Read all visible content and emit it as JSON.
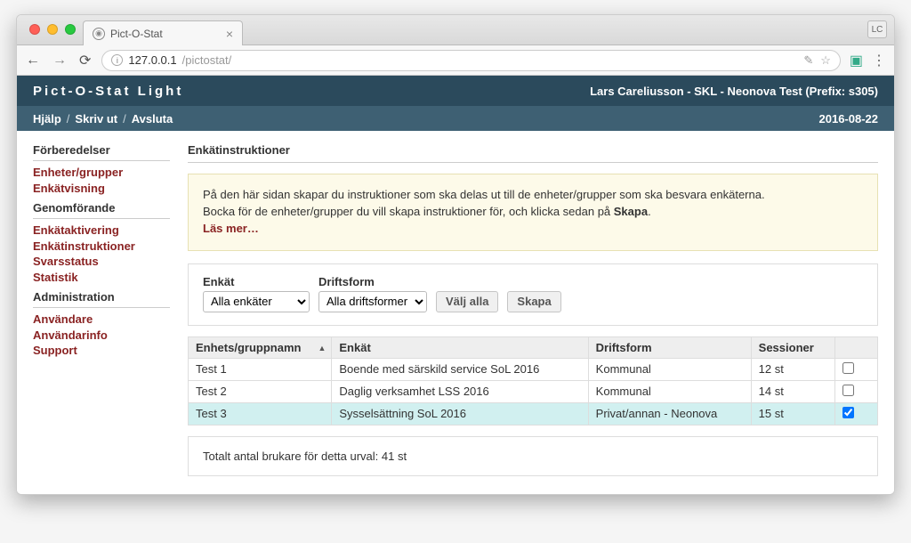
{
  "browser": {
    "tab_title": "Pict-O-Stat",
    "profile_badge": "LC",
    "url_host": "127.0.0.1",
    "url_path": "/pictostat/"
  },
  "header": {
    "app_title": "Pict-O-Stat Light",
    "user_info": "Lars Careliusson - SKL - Neonova Test (Prefix: s305)"
  },
  "subheader": {
    "help": "Hjälp",
    "print": "Skriv ut",
    "logout": "Avsluta",
    "date": "2016-08-22"
  },
  "sidebar": {
    "sections": [
      {
        "heading": "Förberedelser",
        "items": [
          "Enheter/grupper",
          "Enkätvisning"
        ]
      },
      {
        "heading": "Genomförande",
        "items": [
          "Enkätaktivering",
          "Enkätinstruktioner",
          "Svarsstatus",
          "Statistik"
        ]
      },
      {
        "heading": "Administration",
        "items": [
          "Användare",
          "Användarinfo",
          "Support"
        ]
      }
    ]
  },
  "main": {
    "title": "Enkätinstruktioner",
    "info_line1": "På den här sidan skapar du instruktioner som ska delas ut till de enheter/grupper som ska besvara enkäterna.",
    "info_line2a": "Bocka för de enheter/grupper du vill skapa instruktioner för, och klicka sedan på ",
    "info_line2b": "Skapa",
    "info_line2c": ".",
    "read_more": "Läs mer…",
    "filters": {
      "enkat_label": "Enkät",
      "enkat_value": "Alla enkäter",
      "drift_label": "Driftsform",
      "drift_value": "Alla driftsformer",
      "select_all": "Välj alla",
      "create": "Skapa"
    },
    "table": {
      "headers": {
        "name": "Enhets/gruppnamn",
        "enkat": "Enkät",
        "drift": "Driftsform",
        "sessions": "Sessioner"
      },
      "rows": [
        {
          "name": "Test 1",
          "enkat": "Boende med särskild service SoL 2016",
          "drift": "Kommunal",
          "sessions": "12 st",
          "checked": false,
          "highlight": false
        },
        {
          "name": "Test 2",
          "enkat": "Daglig verksamhet LSS 2016",
          "drift": "Kommunal",
          "sessions": "14 st",
          "checked": false,
          "highlight": false
        },
        {
          "name": "Test 3",
          "enkat": "Sysselsättning SoL 2016",
          "drift": "Privat/annan - Neonova",
          "sessions": "15 st",
          "checked": true,
          "highlight": true
        }
      ]
    },
    "summary": "Totalt antal brukare för detta urval: 41 st"
  }
}
